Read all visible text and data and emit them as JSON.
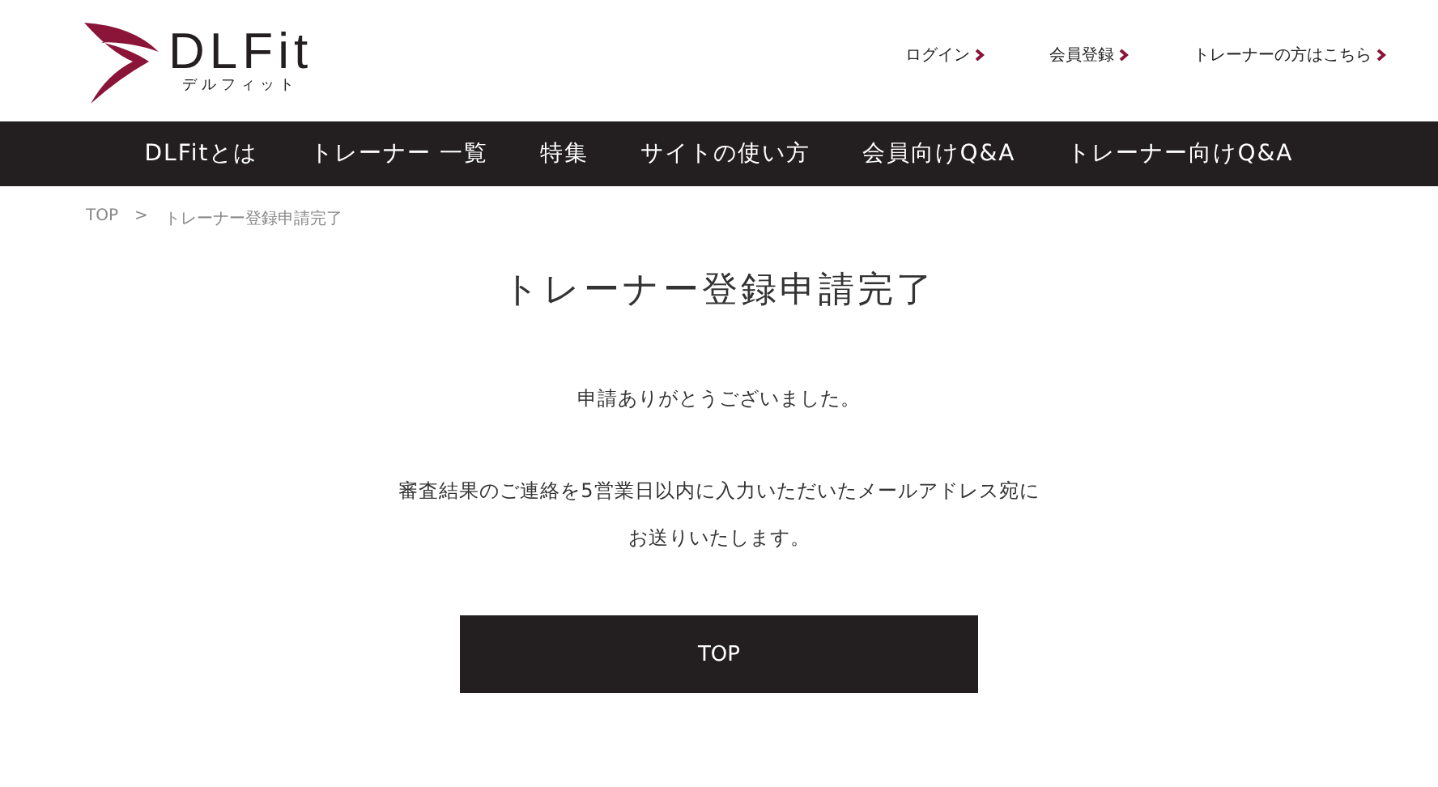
{
  "logo": {
    "name": "DLFit",
    "reading": "デルフィット"
  },
  "header_links": [
    {
      "label": "ログイン"
    },
    {
      "label": "会員登録"
    },
    {
      "label": "トレーナーの方はこちら"
    }
  ],
  "nav": [
    {
      "label": "DLFitとは"
    },
    {
      "label": "トレーナー 一覧"
    },
    {
      "label": "特集"
    },
    {
      "label": "サイトの使い方"
    },
    {
      "label": "会員向けQ&A"
    },
    {
      "label": "トレーナー向けQ&A"
    }
  ],
  "breadcrumb": {
    "items": [
      "TOP",
      "トレーナー登録申請完了"
    ],
    "separator": ">"
  },
  "title": "トレーナー登録申請完了",
  "messages": [
    "申請ありがとうございました。",
    "審査結果のご連絡を5営業日以内に入力いただいたメールアドレス宛に",
    "お送りいたします。"
  ],
  "button": "TOP"
}
